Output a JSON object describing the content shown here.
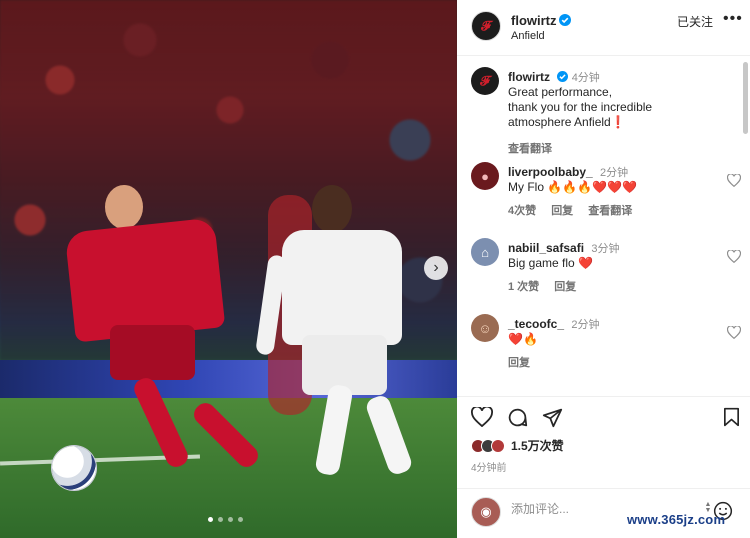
{
  "post": {
    "username": "flowirtz",
    "location": "Anfield",
    "follow_label": "已关注",
    "more_label": "•••"
  },
  "caption": {
    "username": "flowirtz",
    "time": "4分钟",
    "text_lines": [
      "Great performance,",
      "thank you for the incredible",
      "atmosphere Anfield❗"
    ],
    "translate_label": "查看翻译"
  },
  "comments": [
    {
      "username": "liverpoolbaby_",
      "time": "2分钟",
      "text": "My Flo 🔥🔥🔥❤️❤️❤️",
      "likes": "4次赞",
      "reply": "回复",
      "translate": "查看翻译"
    },
    {
      "username": "nabiil_safsafi",
      "time": "3分钟",
      "text": "Big game flo ❤️",
      "likes": "1 次赞",
      "reply": "回复"
    },
    {
      "username": "_tecoofc_",
      "time": "2分钟",
      "text": "❤️🔥",
      "reply": "回复"
    }
  ],
  "engagement": {
    "likes": "1.5万次赞",
    "posted": "4分钟前"
  },
  "comment_input": {
    "placeholder": "添加评论..."
  },
  "watermark": "www.365jz.com",
  "colors": {
    "verified": "#0095f6",
    "liverpool_red": "#c8102e",
    "link_blue": "#1b3f88"
  },
  "icons": [
    "verified-badge",
    "heart",
    "comment",
    "share",
    "bookmark",
    "emoji",
    "chevron-right"
  ],
  "carousel": {
    "slides": 4,
    "active": 1
  }
}
